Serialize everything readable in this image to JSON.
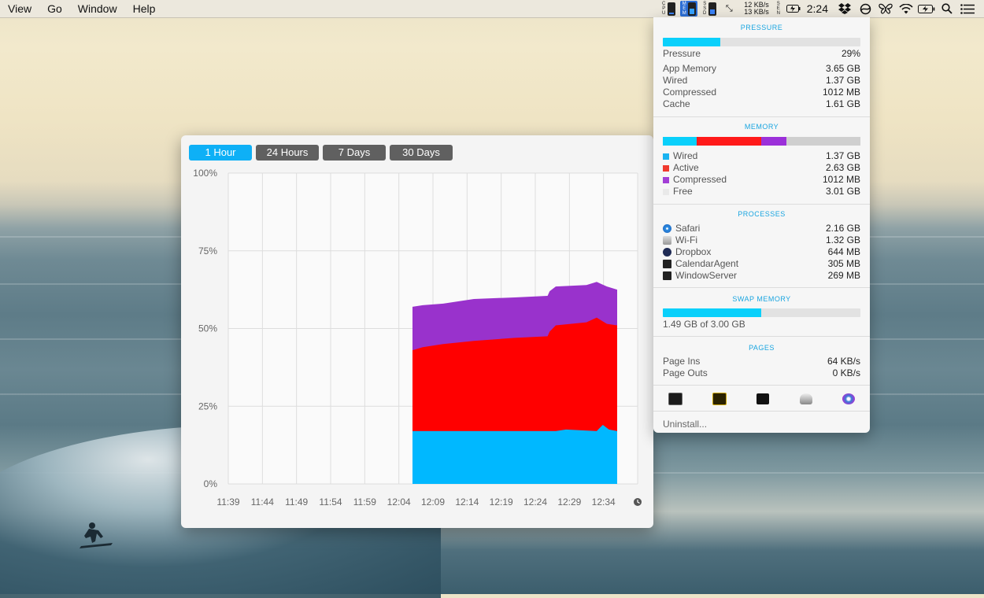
{
  "menubar": {
    "items": [
      "View",
      "Go",
      "Window",
      "Help"
    ],
    "indicators": {
      "cpu_tag": "C P U",
      "mem_tag": "M E M",
      "ssd_tag": "S S D",
      "net_up": "12 KB/s",
      "net_down": "13 KB/s",
      "sen_tag": "S E N"
    },
    "clock": "2:24"
  },
  "chart_window": {
    "tabs": [
      "1 Hour",
      "24 Hours",
      "7 Days",
      "30 Days"
    ],
    "active_tab": 0
  },
  "chart_data": {
    "type": "area",
    "stacked": true,
    "x": [
      "11:39",
      "11:44",
      "11:49",
      "11:54",
      "11:59",
      "12:04",
      "12:09",
      "12:14",
      "12:19",
      "12:24",
      "12:29",
      "12:34"
    ],
    "y_ticks": [
      "100%",
      "75%",
      "50%",
      "25%",
      "0%"
    ],
    "ylim": [
      0,
      100
    ],
    "data_start": "12:06",
    "data_end": "12:36",
    "series": [
      {
        "name": "Wired",
        "color": "#00b8ff",
        "points": [
          [
            0,
            17
          ],
          [
            0.2,
            17
          ],
          [
            0.4,
            17
          ],
          [
            0.6,
            17
          ],
          [
            0.7,
            17
          ],
          [
            0.75,
            17.5
          ],
          [
            0.9,
            17
          ],
          [
            0.93,
            19
          ],
          [
            0.96,
            17.5
          ],
          [
            1,
            17
          ]
        ]
      },
      {
        "name": "Active",
        "color": "#ff0000",
        "points": [
          [
            0,
            43
          ],
          [
            0.05,
            44
          ],
          [
            0.15,
            45
          ],
          [
            0.3,
            46
          ],
          [
            0.5,
            47
          ],
          [
            0.66,
            47.5
          ],
          [
            0.67,
            49
          ],
          [
            0.7,
            51
          ],
          [
            0.85,
            52
          ],
          [
            0.9,
            53.5
          ],
          [
            0.95,
            51.5
          ],
          [
            1,
            51
          ]
        ]
      },
      {
        "name": "Compressed",
        "color": "#9932cc",
        "points": [
          [
            0,
            57
          ],
          [
            0.05,
            57.5
          ],
          [
            0.15,
            58
          ],
          [
            0.3,
            59.5
          ],
          [
            0.5,
            60
          ],
          [
            0.66,
            60.5
          ],
          [
            0.67,
            62
          ],
          [
            0.7,
            63.5
          ],
          [
            0.85,
            64
          ],
          [
            0.9,
            65
          ],
          [
            0.95,
            63.5
          ],
          [
            1,
            62.5
          ]
        ]
      }
    ],
    "grid": true
  },
  "panel": {
    "pressure": {
      "title": "PRESSURE",
      "percent": 29,
      "label": "Pressure",
      "value": "29%",
      "rows": [
        {
          "label": "App Memory",
          "value": "3.65 GB"
        },
        {
          "label": "Wired",
          "value": "1.37 GB"
        },
        {
          "label": "Compressed",
          "value": "1012 MB"
        },
        {
          "label": "Cache",
          "value": "1.61 GB"
        }
      ]
    },
    "memory": {
      "title": "MEMORY",
      "segments": [
        {
          "name": "Wired",
          "gb": 1.37,
          "color": "#0ad0fb"
        },
        {
          "name": "Active",
          "gb": 2.63,
          "color": "#ff1a1a"
        },
        {
          "name": "Compressed",
          "gb": 0.99,
          "color": "#9b30d9"
        },
        {
          "name": "Free",
          "gb": 3.01,
          "color": "#cfcfcf"
        }
      ],
      "rows": [
        {
          "label": "Wired",
          "value": "1.37 GB",
          "color": "#1ab3f0"
        },
        {
          "label": "Active",
          "value": "2.63 GB",
          "color": "#f03a2e"
        },
        {
          "label": "Compressed",
          "value": "1012 MB",
          "color": "#a23fd6"
        },
        {
          "label": "Free",
          "value": "3.01 GB",
          "color": "#e9e9e9"
        }
      ]
    },
    "processes": {
      "title": "PROCESSES",
      "rows": [
        {
          "label": "Safari",
          "value": "2.16 GB",
          "icon": "safari-icon"
        },
        {
          "label": "Wi-Fi",
          "value": "1.32 GB",
          "icon": "wifi-app-icon"
        },
        {
          "label": "Dropbox",
          "value": "644 MB",
          "icon": "dropbox-icon"
        },
        {
          "label": "CalendarAgent",
          "value": "305 MB",
          "icon": "terminal-icon"
        },
        {
          "label": "WindowServer",
          "value": "269 MB",
          "icon": "terminal-icon"
        }
      ]
    },
    "swap": {
      "title": "SWAP MEMORY",
      "used_gb": 1.49,
      "total_gb": 3.0,
      "text": "1.49 GB of 3.00 GB"
    },
    "pages": {
      "title": "PAGES",
      "rows": [
        {
          "label": "Page Ins",
          "value": "64 KB/s"
        },
        {
          "label": "Page Outs",
          "value": "0 KB/s"
        }
      ]
    },
    "dock_icons": [
      "activity-monitor-icon",
      "marked-icon",
      "terminal-icon",
      "utility-icon",
      "disk-diag-icon"
    ],
    "uninstall": "Uninstall..."
  }
}
